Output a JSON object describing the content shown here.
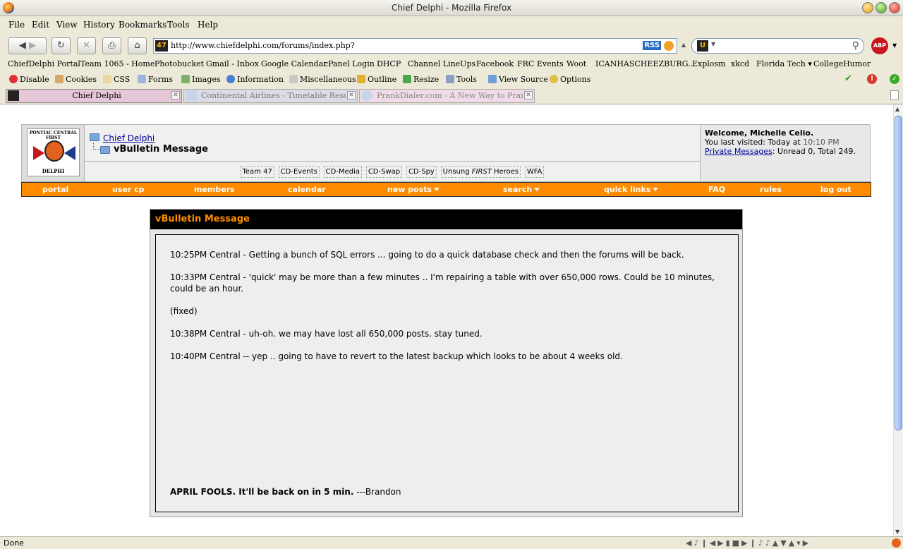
{
  "window": {
    "title": "Chief Delphi - Mozilla Firefox"
  },
  "menu": [
    "File",
    "Edit",
    "View",
    "History",
    "Bookmarks",
    "Tools",
    "Help"
  ],
  "nav": {
    "back_icon": "back-arrow-icon",
    "forward_icon": "forward-arrow-icon",
    "url": "http://www.chiefdelphi.com/forums/index.php?",
    "url_favicon": "47",
    "rss_label": "RSS",
    "search_engine": "U",
    "abp_label": "ABP"
  },
  "bookmarks": [
    "ChiefDelphi Portal",
    "Team 1065 - Home",
    "Photobucket",
    "Gmail - Inbox",
    "Google Calendar",
    "cPanel Login",
    "DHCP",
    "Channel LineUps",
    "Facebook",
    "FRC Events",
    "Woot",
    "ICANHASCHEEZBURG...",
    "Explosm",
    "xkcd",
    "Florida Tech ▾",
    "CollegeHumor"
  ],
  "devtools": [
    "Disable",
    "Cookies",
    "CSS",
    "Forms",
    "Images",
    "Information",
    "Miscellaneous",
    "Outline",
    "Resize",
    "Tools",
    "View Source",
    "Options"
  ],
  "tabs": [
    {
      "label": "Chief Delphi",
      "active": true
    },
    {
      "label": "Continental Airlines - Timetable Results",
      "active": false
    },
    {
      "label": "PrankDialer.com - A New Way to Prank Y...",
      "active": false
    }
  ],
  "header": {
    "logo_top": "PONTIAC CENTRAL FIRST",
    "logo_bottom": "DELPHI",
    "crumb_link": "Chief Delphi",
    "crumb_current": "vBulletin Message",
    "sublinks": [
      "Team 47",
      "CD-Events",
      "CD-Media",
      "CD-Swap",
      "CD-Spy",
      "WFA"
    ],
    "unsung_pre": "Unsung ",
    "unsung_em": "FIRST",
    "unsung_post": " Heroes",
    "welcome_title": "Welcome, Michelle Celio.",
    "last_visited_label": "You last visited: Today at ",
    "last_visited_time": "10:10 PM",
    "pm_link": "Private Messages",
    "pm_counts": ": Unread 0, Total 249."
  },
  "orange_nav": [
    "portal",
    "user cp",
    "members",
    "calendar",
    "new posts",
    "search",
    "quick links",
    "FAQ",
    "rules",
    "log out"
  ],
  "message": {
    "title": "vBulletin Message",
    "paragraphs": [
      "10:25PM Central - Getting a bunch of SQL errors ... going to do a quick database check and then the forums will be back.",
      "10:33PM Central - 'quick' may be more than a few minutes .. I'm repairing a table with over 650,000 rows. Could be 10 minutes, could be an hour.",
      "(fixed)",
      "10:38PM Central - uh-oh. we may have lost all 650,000 posts. stay tuned.",
      "10:40PM Central -- yep .. going to have to revert to the latest backup which looks to be about 4 weeks old."
    ],
    "signoff_bold": "APRIL FOOLS. It'll be back on in 5 min.",
    "signoff_rest": " ---Brandon"
  },
  "status": {
    "text": "Done"
  }
}
